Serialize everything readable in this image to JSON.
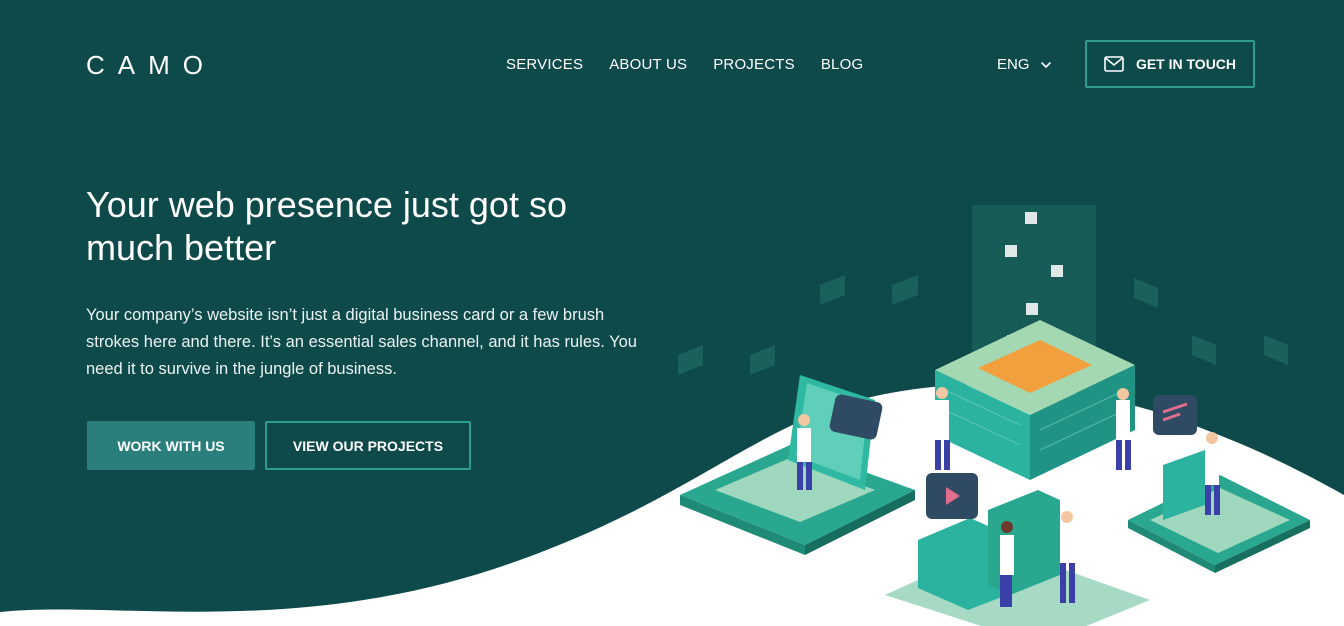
{
  "header": {
    "logo": "CAMO",
    "nav": [
      "SERVICES",
      "ABOUT US",
      "PROJECTS",
      "BLOG"
    ],
    "language": "ENG",
    "cta_label": "GET IN TOUCH"
  },
  "hero": {
    "title": "Your web presence just got so much better",
    "description": "Your company’s website isn’t just a digital business card or a few brush strokes here and there. It’s an essential sales channel, and it has rules. You need it to survive in the jungle of business.",
    "primary_button": "WORK WITH US",
    "secondary_button": "VIEW OUR PROJECTS"
  },
  "colors": {
    "background": "#0f4a4a",
    "accent": "#2a7f7d",
    "outline": "#2e9e92",
    "wave": "#ffffff"
  },
  "icons": {
    "cta": "mail-icon",
    "language": "chevron-down-icon"
  }
}
